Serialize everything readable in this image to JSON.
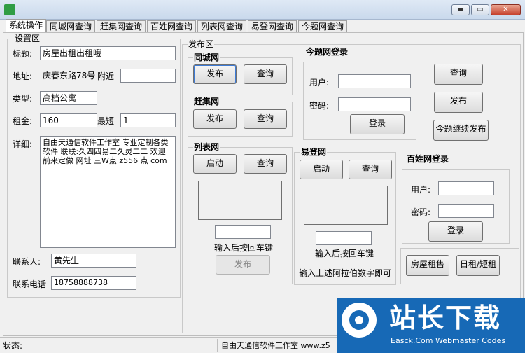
{
  "window": {
    "minimize": "▬",
    "restore": "▭",
    "close": "✕"
  },
  "tabs": [
    "系统操作",
    "同城网查询",
    "赶集网查询",
    "百姓网查询",
    "列表网查询",
    "易登网查询",
    "今题网查询"
  ],
  "settings": {
    "group_label": "设置区",
    "title_label": "标题:",
    "title_value": "房屋出租出租哦",
    "address_label": "地址:",
    "address_value": "庆春东路78号",
    "near_label": "附近",
    "near_value": "",
    "type_label": "类型:",
    "type_value": "高档公寓",
    "rent_label": "租金:",
    "rent_value": "160",
    "min_label": "最短",
    "min_value": "1",
    "detail_label": "详细:",
    "detail_value": "自由天通信软件工作室 专业定制各类软件 联联:久四四易二久灵二二 欢迎前来定做 网址 三W点 z556 点 com",
    "contact_label": "联系人:",
    "contact_value": "黄先生",
    "phone_label": "联系电话",
    "phone_value": "18758888738"
  },
  "publish": {
    "group_label": "发布区",
    "tongcheng": {
      "label": "同城网",
      "publish": "发布",
      "query": "查询"
    },
    "ganji": {
      "label": "赶集网",
      "publish": "发布",
      "query": "查询"
    },
    "liebiao": {
      "label": "列表网",
      "start": "启动",
      "query": "查询",
      "hint": "输入后按回车键",
      "publish": "发布"
    },
    "jinti": {
      "label": "今题网登录",
      "user_label": "用户:",
      "pass_label": "密码:",
      "login": "登录",
      "query": "查询",
      "publish": "发布",
      "continue": "今题继续发布"
    },
    "yideng": {
      "label": "易登网",
      "start": "启动",
      "query": "查询",
      "hint": "输入后按回车键",
      "hint2": "输入上述阿拉伯数字即可"
    },
    "baixing": {
      "label": "百姓网登录",
      "user_label": "用户:",
      "pass_label": "密码:",
      "login": "登录",
      "rent": "房屋租售",
      "short": "日租/短租"
    }
  },
  "status": {
    "label": "状态:",
    "text": "自由天通信软件工作室 www.z5"
  },
  "watermark": {
    "title": "站长下载",
    "sub": "Easck.Com Webmaster Codes"
  }
}
